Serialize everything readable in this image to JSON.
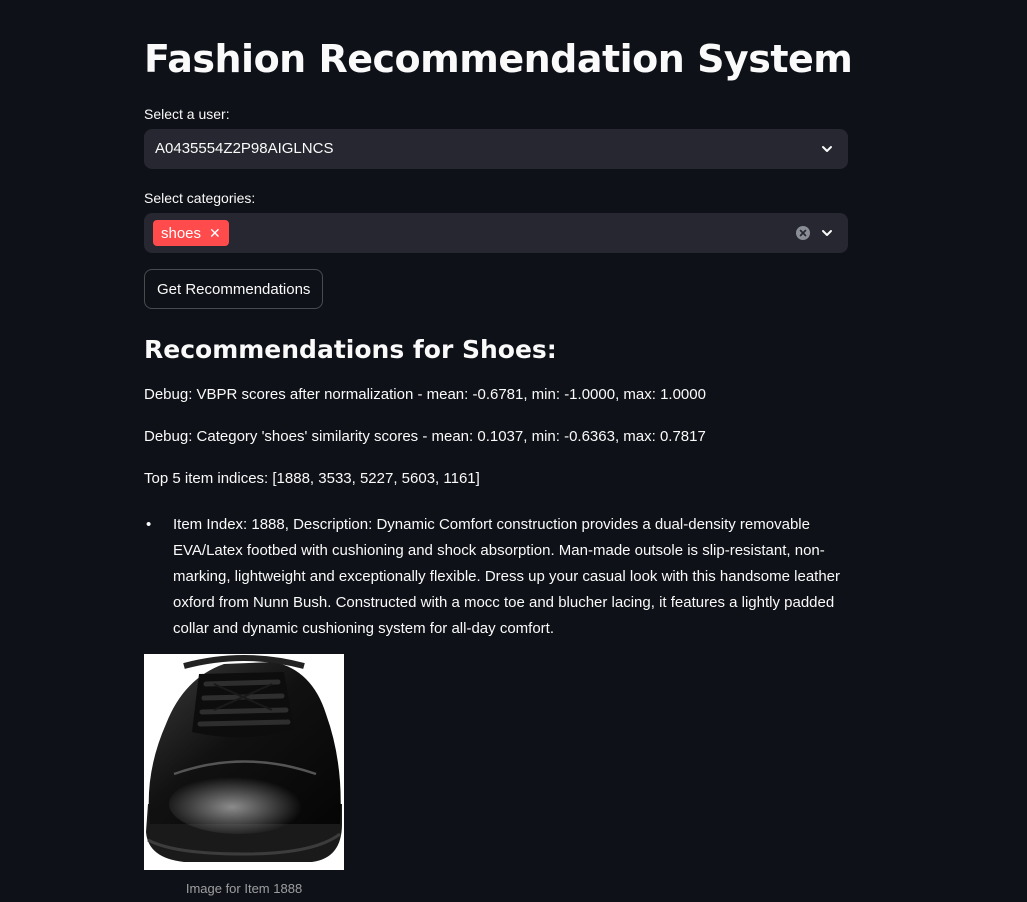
{
  "app": {
    "title": "Fashion Recommendation System"
  },
  "user_select": {
    "label": "Select a user:",
    "value": "A0435554Z2P98AIGLNCS"
  },
  "category_select": {
    "label": "Select categories:",
    "tags": [
      "shoes"
    ]
  },
  "button": {
    "label": "Get Recommendations"
  },
  "results": {
    "heading": "Recommendations for Shoes:",
    "debug_vbpr": "Debug: VBPR scores after normalization - mean: -0.6781, min: -1.0000, max: 1.0000",
    "debug_category": "Debug: Category 'shoes' similarity scores - mean: 0.1037, min: -0.6363, max: 0.7817",
    "top_indices": "Top 5 item indices: [1888, 3533, 5227, 5603, 1161]",
    "items": [
      {
        "text": "Item Index: 1888, Description: Dynamic Comfort construction provides a dual-density removable EVA/Latex footbed with cushioning and shock absorption. Man-made outsole is slip-resistant, non-marking, lightweight and exceptionally flexible. Dress up your casual look with this handsome leather oxford from Nunn Bush. Constructed with a mocc toe and blucher lacing, it features a lightly padded collar and dynamic cushioning system for all-day comfort.",
        "caption": "Image for Item 1888"
      }
    ]
  },
  "colors": {
    "background": "#0e1117",
    "input_bg": "#262730",
    "accent": "#ff4b4b",
    "text": "#fafafa"
  }
}
